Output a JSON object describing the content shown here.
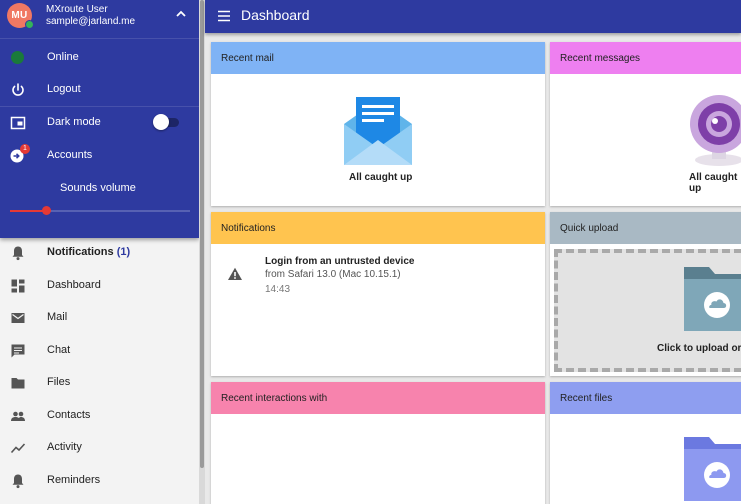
{
  "user": {
    "initials": "MU",
    "name": "MXroute User",
    "email": "sample@jarland.me"
  },
  "status_menu": {
    "online": "Online",
    "logout": "Logout",
    "dark_mode": "Dark mode",
    "accounts": "Accounts",
    "accounts_badge": "1",
    "sounds_volume": "Sounds volume",
    "volume_level": 0.2,
    "dark_mode_on": false
  },
  "nav": {
    "notifications": "Notifications",
    "notifications_count": "(1)",
    "dashboard": "Dashboard",
    "mail": "Mail",
    "chat": "Chat",
    "files": "Files",
    "contacts": "Contacts",
    "activity": "Activity",
    "reminders": "Reminders"
  },
  "topbar": {
    "title": "Dashboard"
  },
  "cards": {
    "recent_mail": {
      "title": "Recent mail",
      "status": "All caught up"
    },
    "recent_messages": {
      "title": "Recent messages",
      "status": "All caught up"
    },
    "notifications": {
      "title": "Notifications",
      "item_title": "Login from an untrusted device",
      "item_sub": "from Safari 13.0 (Mac 10.15.1)",
      "item_time": "14:43"
    },
    "quick_upload": {
      "title": "Quick upload",
      "hint": "Click to upload or drag"
    },
    "recent_interactions": {
      "title": "Recent interactions with"
    },
    "recent_files": {
      "title": "Recent files"
    }
  },
  "colors": {
    "primary": "#2e3aa0",
    "mail_header": "#7fb3f5",
    "messages_header": "#ee7ff0",
    "notifications_header": "#ffc44f",
    "upload_header": "#a9b9c4",
    "interactions_header": "#f783ad",
    "files_header": "#8e9ef0",
    "online": "#1a7a3a",
    "accent_red": "#e53935"
  }
}
